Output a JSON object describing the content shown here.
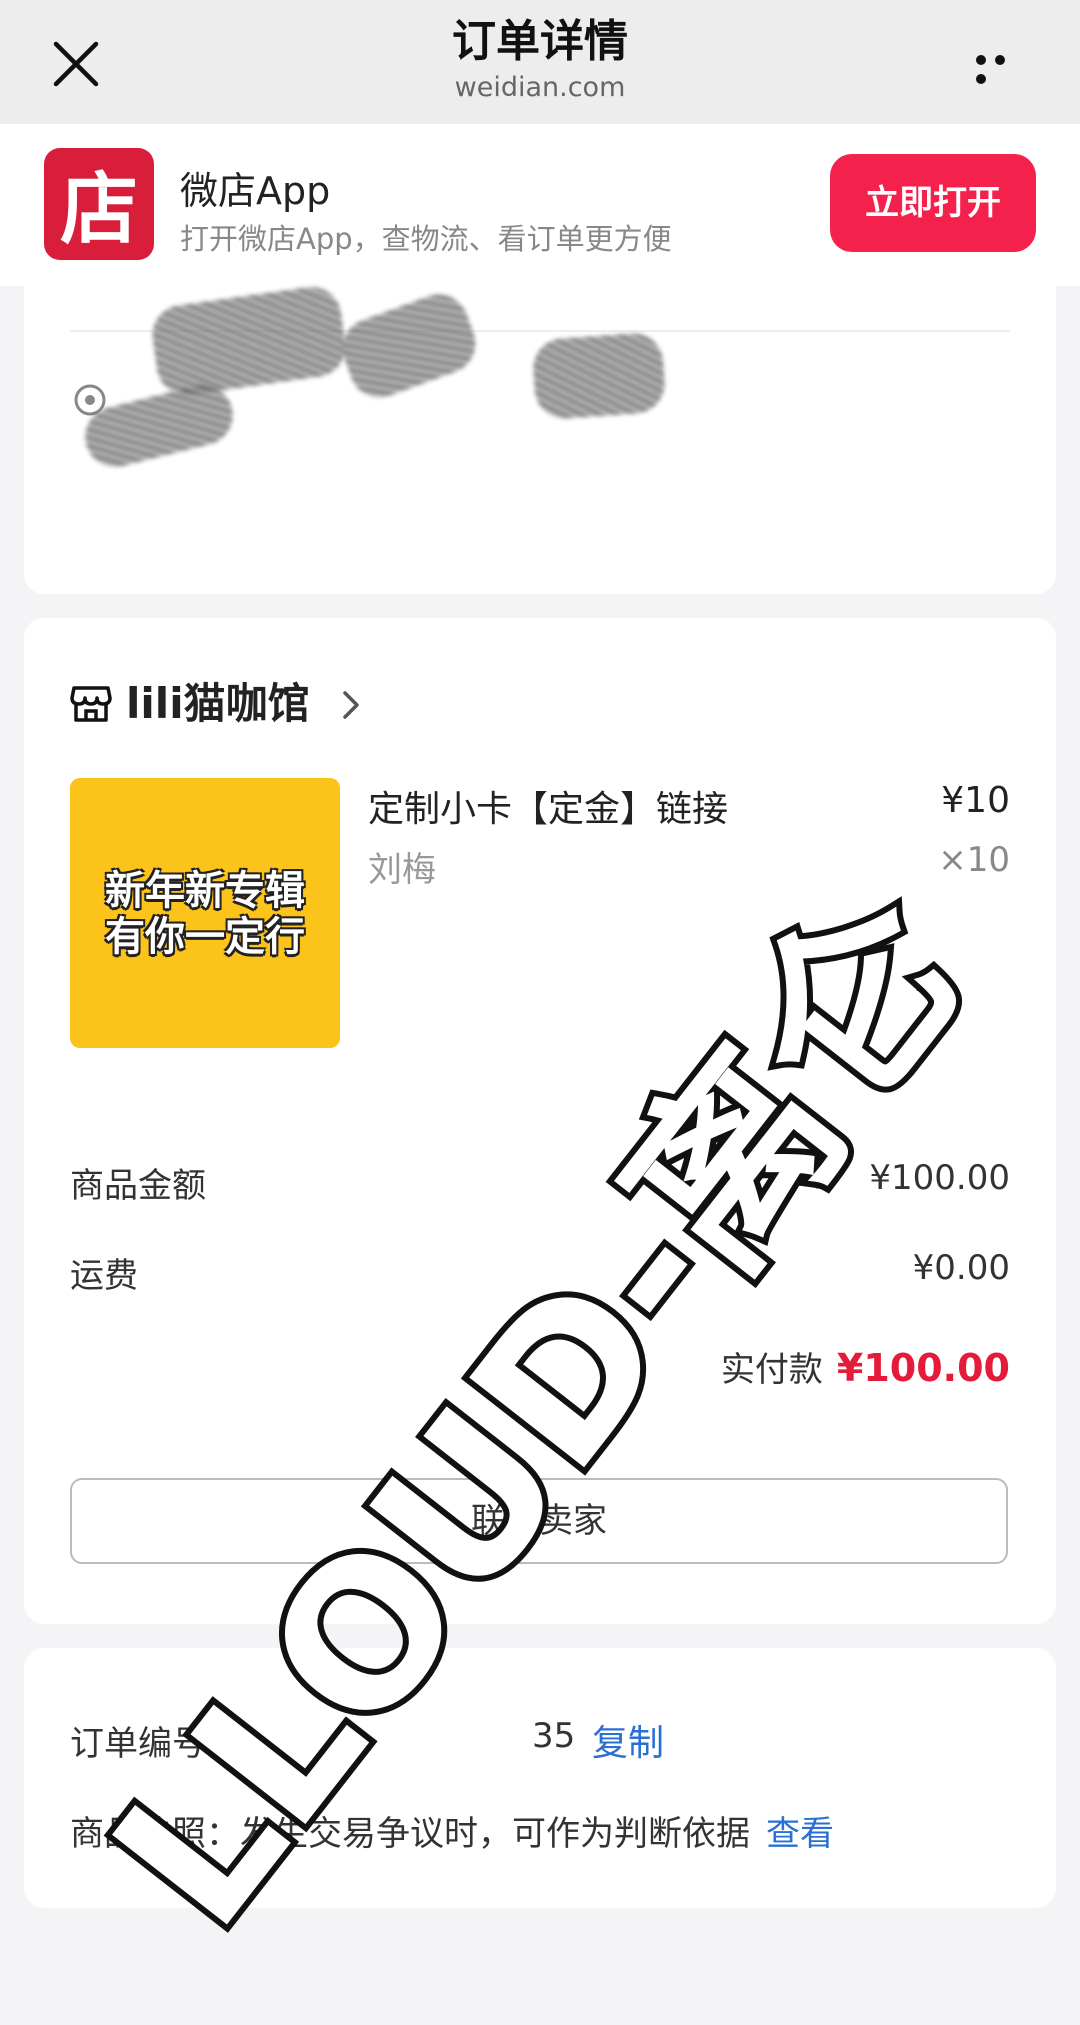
{
  "navbar": {
    "title": "订单详情",
    "domain": "weidian.com"
  },
  "app_banner": {
    "logo_char": "店",
    "name": "微店App",
    "description": "打开微店App，查物流、看订单更方便",
    "open_button": "立即打开"
  },
  "shop": {
    "name": "lili猫咖馆"
  },
  "product": {
    "image_text_line1": "新年新专辑",
    "image_text_line2": "有你一定行",
    "title": "定制小卡【定金】链接",
    "spec": "刘梅",
    "price": "¥10",
    "quantity": "×10"
  },
  "summary": {
    "goods_amount_label": "商品金额",
    "goods_amount_value": "¥100.00",
    "shipping_label": "运费",
    "shipping_value": "¥0.00",
    "paid_label": "实付款",
    "paid_value": "¥100.00"
  },
  "contact_button": "联系卖家",
  "order": {
    "number_label": "订单编号:",
    "number_value": "35",
    "copy_link": "复制",
    "note": "商品快照：发生交易争议时，可作为判断依据",
    "view_link": "查看"
  },
  "watermark": {
    "text": "LLOUD-离仑"
  },
  "colors": {
    "brand_red": "#d81e3a",
    "open_button": "#f5214d",
    "price_red": "#e41c3a",
    "link_blue": "#2a6fd6",
    "product_yellow": "#fcc31b"
  },
  "icons": [
    "close-icon",
    "more-icon",
    "location-pin-icon",
    "shop-icon",
    "chevron-right-icon"
  ]
}
